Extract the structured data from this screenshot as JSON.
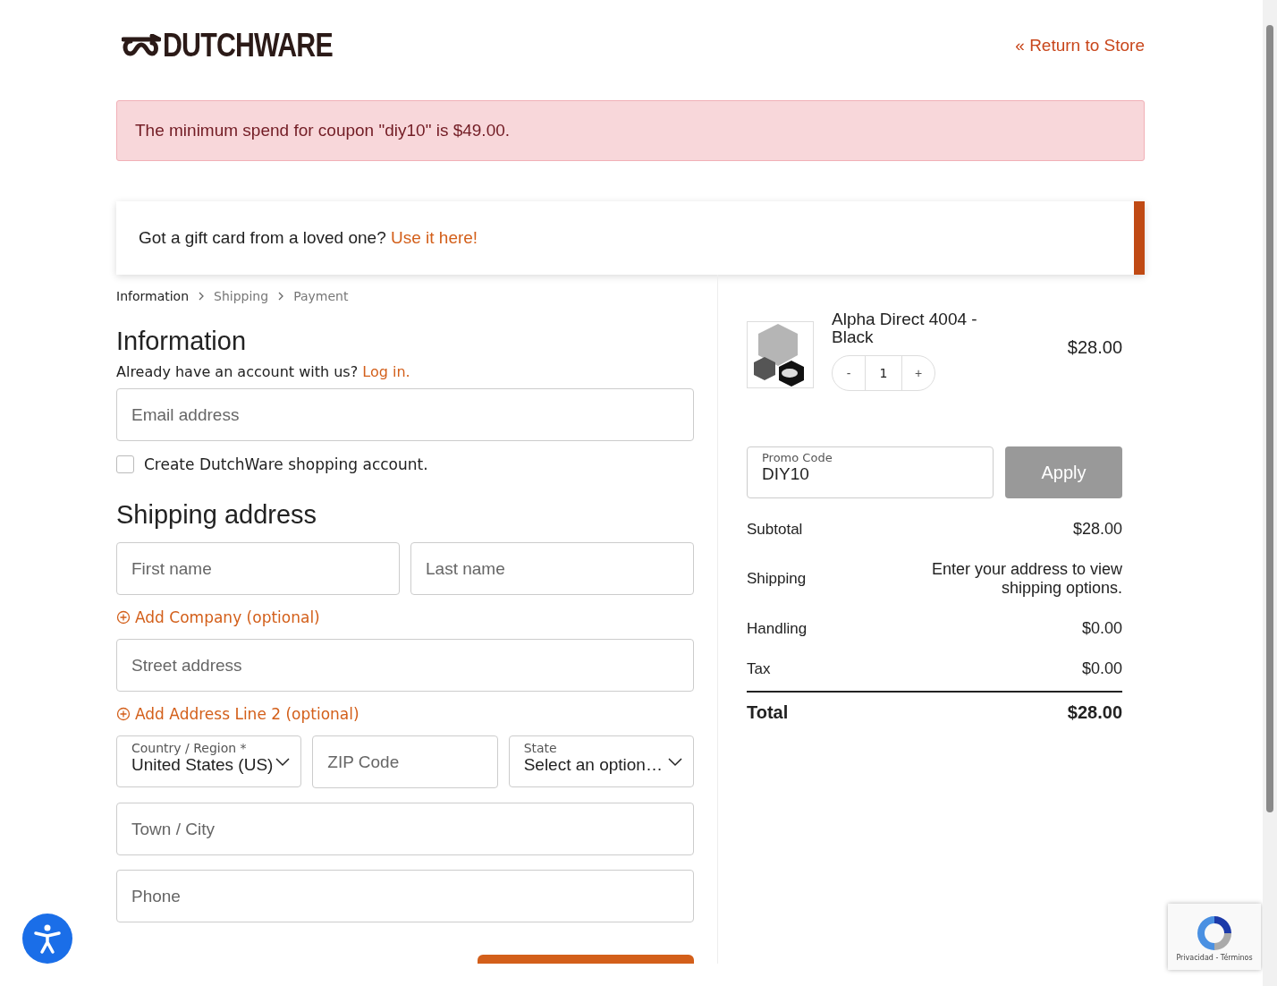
{
  "header": {
    "logo": "DUTCHWARE",
    "return_link": "« Return to Store"
  },
  "error_notice": "The minimum spend for coupon \"diy10\" is $49.00.",
  "gift_card": {
    "text": "Got a gift card from a loved one?",
    "link": "Use it here!"
  },
  "breadcrumb": [
    {
      "label": "Information",
      "selected": true
    },
    {
      "label": "Shipping",
      "selected": false
    },
    {
      "label": "Payment",
      "selected": false
    }
  ],
  "information": {
    "title": "Information",
    "login_prompt": "Already have an account with us?",
    "login_link": "Log in.",
    "email": {
      "placeholder": "Email address"
    },
    "create_account": {
      "label": "Create DutchWare shopping account.",
      "checked": false
    }
  },
  "shipping_address": {
    "title": "Shipping address",
    "first_name": {
      "placeholder": "First name"
    },
    "last_name": {
      "placeholder": "Last name"
    },
    "add_company": "Add Company (optional)",
    "street": {
      "placeholder": "Street address"
    },
    "add_line2": "Add Address Line 2 (optional)",
    "country": {
      "label": "Country / Region *",
      "value": "United States (US)"
    },
    "zip": {
      "placeholder": "ZIP Code"
    },
    "state": {
      "label": "State",
      "value": "Select an option…"
    },
    "city": {
      "placeholder": "Town / City"
    },
    "phone": {
      "placeholder": "Phone"
    }
  },
  "cart": {
    "items": [
      {
        "name": "Alpha Direct 4004 - Black",
        "quantity": "1",
        "minus": "-",
        "plus": "+",
        "price": "$28.00"
      }
    ],
    "promo": {
      "label": "Promo Code",
      "value": "DIY10",
      "button": "Apply"
    },
    "totals": [
      {
        "label": "Subtotal",
        "value": "$28.00"
      },
      {
        "label": "Shipping",
        "value": "Enter your address to view shipping options."
      },
      {
        "label": "Handling",
        "value": "$0.00"
      },
      {
        "label": "Tax",
        "value": "$0.00"
      }
    ],
    "total": {
      "label": "Total",
      "value": "$28.00"
    }
  },
  "recaptcha": {
    "links": "Privacidad - Términos"
  }
}
